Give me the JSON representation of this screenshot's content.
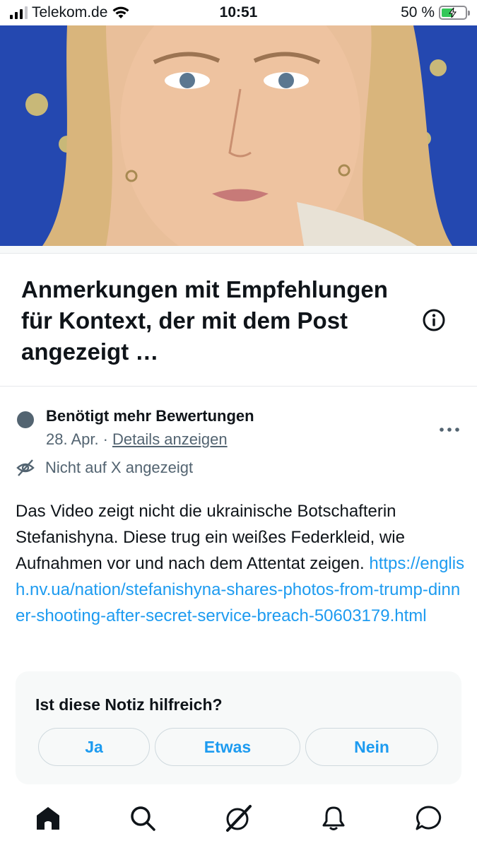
{
  "status_bar": {
    "carrier": "Telekom.de",
    "time": "10:51",
    "battery": "50 %"
  },
  "heading": {
    "title": "Anmerkungen mit Empfehlungen für Kontext, der mit dem Post angezeigt …"
  },
  "note": {
    "status": "Benötigt mehr Bewertungen",
    "date": "28. Apr.",
    "separator": "·",
    "details_link": "Details anzeigen",
    "visibility": "Nicht auf X angezeigt",
    "text": "Das Video zeigt nicht die ukrainische Botschafterin Stefanishyna. Diese trug ein weißes Federkleid, wie Aufnahmen vor und nach dem Attentat zeigen.",
    "url": "https://english.nv.ua/nation/stefanishyna-shares-photos-from-trump-dinner-shooting-after-secret-service-breach-50603179.html"
  },
  "rating": {
    "question": "Ist diese Notiz hilfreich?",
    "yes": "Ja",
    "somewhat": "Etwas",
    "no": "Nein"
  },
  "tabbar": {
    "items": [
      "home-icon",
      "search-icon",
      "grok-icon",
      "notifications-icon",
      "messages-icon"
    ]
  },
  "colors": {
    "accent": "#1d9bf0",
    "secondary_text": "#536471",
    "card_bg": "#f7f9f9",
    "battery_green": "#34c759"
  }
}
